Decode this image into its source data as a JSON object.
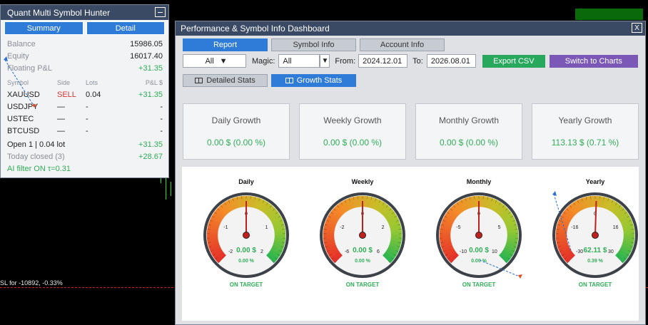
{
  "left_panel": {
    "title": "Quant Multi Symbol Hunter",
    "tabs": [
      "Summary",
      "Detail"
    ],
    "summary": [
      {
        "label": "Balance",
        "value": "15986.05"
      },
      {
        "label": "Equity",
        "value": "16017.40"
      },
      {
        "label": "Floating P&L",
        "value": "+31.35"
      }
    ],
    "table_headers": [
      "Symbol",
      "Side",
      "Lots",
      "P&L $"
    ],
    "rows": [
      {
        "symbol": "XAUUSD",
        "side": "SELL",
        "lots": "0.04",
        "pnl": "+31.35"
      },
      {
        "symbol": "USDJPY",
        "side": "—",
        "lots": "-",
        "pnl": "-"
      },
      {
        "symbol": "USTEC",
        "side": "—",
        "lots": "-",
        "pnl": "-"
      },
      {
        "symbol": "BTCUSD",
        "side": "—",
        "lots": "-",
        "pnl": "-"
      }
    ],
    "open_label": "Open 1 | 0.04 lot",
    "open_value": "+31.35",
    "closed_label": "Today closed (3)",
    "closed_value": "+28.67",
    "ai_filter": "AI filter ON  τ=0.31"
  },
  "chart_overlay": {
    "sl_label": "SL for -10892, -0.33%"
  },
  "dashboard": {
    "title": "Performance & Symbol Info Dashboard",
    "close_glyph": "X",
    "tabs": [
      "Report",
      "Symbol Info",
      "Account Info"
    ],
    "filter_all": "All",
    "magic_label": "Magic:",
    "magic_value": "All",
    "from_label": "From:",
    "from_value": "2024.12.01",
    "to_label": "To:",
    "to_value": "2026.08.01",
    "export_label": "Export CSV",
    "switch_label": "Switch to Charts",
    "subtabs": [
      "Detailed Stats",
      "Growth Stats"
    ],
    "cards": [
      {
        "title": "Daily Growth",
        "value": "0.00 $ (0.00 %)"
      },
      {
        "title": "Weekly Growth",
        "value": "0.00 $ (0.00 %)"
      },
      {
        "title": "Monthly Growth",
        "value": "0.00 $ (0.00 %)"
      },
      {
        "title": "Yearly Growth",
        "value": "113.13 $ (0.71 %)"
      }
    ],
    "gauges": [
      {
        "title": "Daily",
        "value_text": "0.00 $",
        "pct_text": "0.00 %",
        "status": "ON TARGET",
        "ticks": [
          "-2",
          "-1",
          "0",
          "1",
          "2"
        ],
        "min": -2,
        "max": 2,
        "value": 0.0
      },
      {
        "title": "Weekly",
        "value_text": "0.00 $",
        "pct_text": "0.00 %",
        "status": "ON TARGET",
        "ticks": [
          "-6",
          "-2",
          "0",
          "2",
          "6"
        ],
        "min": -6,
        "max": 6,
        "value": 0.0
      },
      {
        "title": "Monthly",
        "value_text": "0.00 $",
        "pct_text": "0.00 %",
        "status": "ON TARGET",
        "ticks": [
          "-10",
          "-5",
          "0",
          "5",
          "10"
        ],
        "min": -10,
        "max": 10,
        "value": 0.0
      },
      {
        "title": "Yearly",
        "value_text": "62.11 $",
        "pct_text": "0.39 %",
        "status": "ON TARGET",
        "ticks": [
          "-30",
          "-16",
          "0",
          "16",
          "30"
        ],
        "min": -30,
        "max": 30,
        "value": 0.39
      }
    ],
    "colors": {
      "accent": "#2f7bd8",
      "positive": "#2fae57",
      "negative": "#d93434",
      "title_bar": "#3a4a64"
    }
  }
}
